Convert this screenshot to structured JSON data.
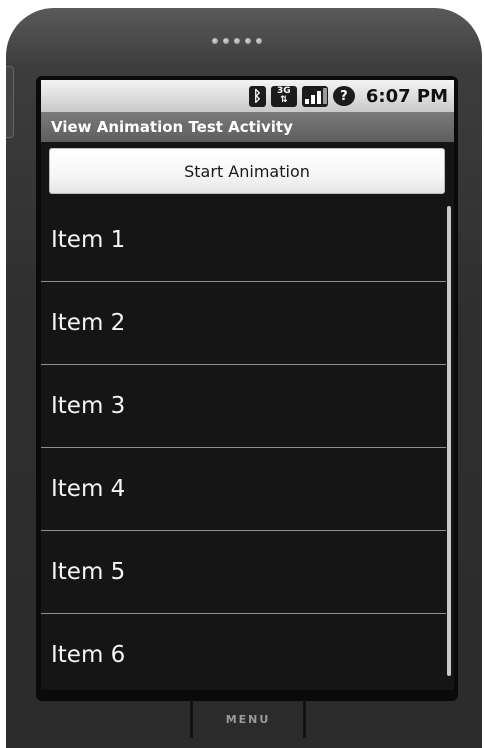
{
  "device": {
    "menu_label": "MENU"
  },
  "statusbar": {
    "time": "6:07 PM",
    "icons": [
      "bluetooth-icon",
      "3g-data-icon",
      "signal-strength-icon",
      "help-question-icon"
    ],
    "network_label": "3G"
  },
  "app": {
    "title": "View Animation Test Activity",
    "start_button_label": "Start Animation"
  },
  "list": {
    "items": [
      {
        "label": "Item 1"
      },
      {
        "label": "Item 2"
      },
      {
        "label": "Item 3"
      },
      {
        "label": "Item 4"
      },
      {
        "label": "Item 5"
      },
      {
        "label": "Item 6"
      }
    ]
  },
  "colors": {
    "screen_background": "#151515",
    "titlebar": "#6a6a6a",
    "statusbar": "#dcdcdc",
    "divider": "#8f8f8f"
  }
}
